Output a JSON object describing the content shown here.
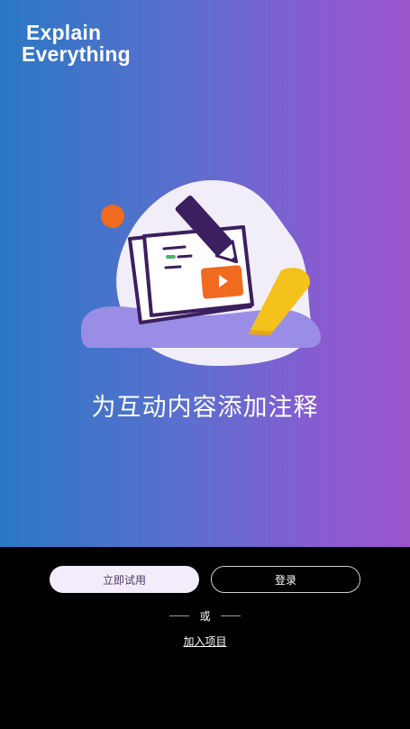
{
  "logo": {
    "line1": "Explain",
    "line2": "Everything"
  },
  "headline": "为互动内容添加注释",
  "actions": {
    "try_label": "立即试用",
    "login_label": "登录",
    "or_label": "或",
    "join_label": "加入项目"
  },
  "colors": {
    "gradient_start": "#2a78c4",
    "gradient_end": "#9a54cc",
    "accent_orange": "#f06a1f",
    "accent_yellow": "#f5c21b",
    "card_purple": "#3b1f5e"
  },
  "icons": [
    "pencil-icon",
    "play-icon",
    "highlighter-icon"
  ]
}
